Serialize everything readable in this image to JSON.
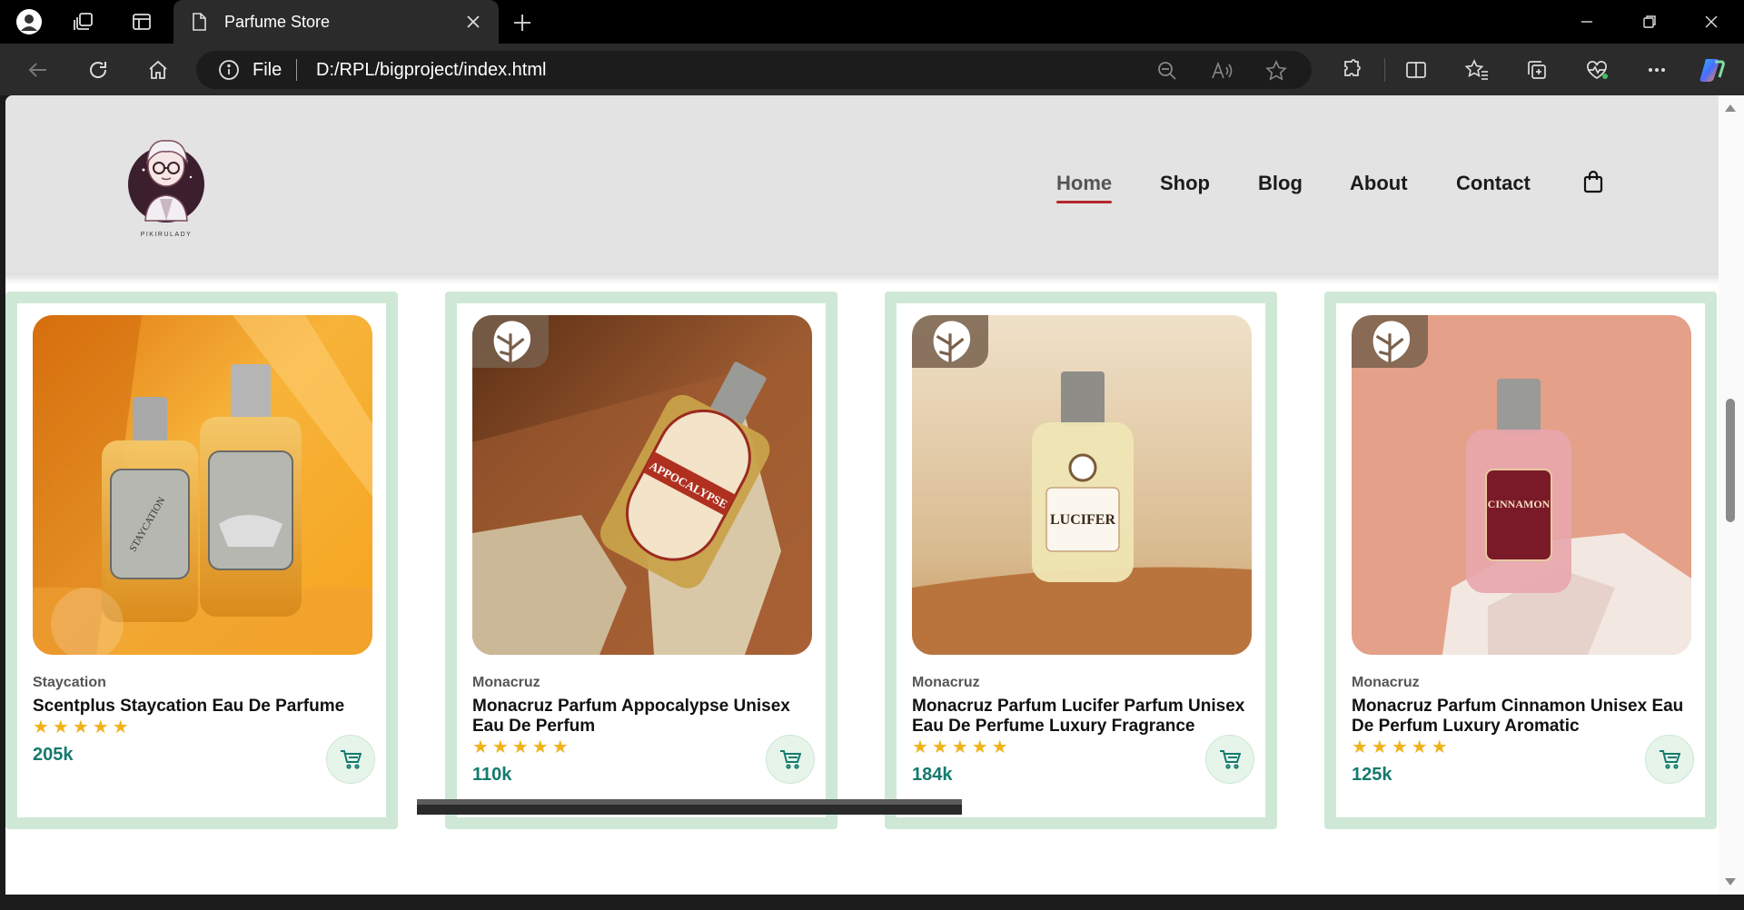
{
  "browser": {
    "tab_title": "Parfume Store",
    "address_scheme": "File",
    "address_url": "D:/RPL/bigproject/index.html"
  },
  "site": {
    "nav": [
      "Home",
      "Shop",
      "Blog",
      "About",
      "Contact"
    ],
    "active_nav": "Home",
    "logo_caption": "PIKIRULADY"
  },
  "products": [
    {
      "brand": "Staycation",
      "name": "Scentplus Staycation Eau De Parfume",
      "rating": 5,
      "price": "205k",
      "label": "STAYCATION"
    },
    {
      "brand": "Monacruz",
      "name": "Monacruz Parfum Appocalypse Unisex Eau De Perfum",
      "rating": 5,
      "price": "110k",
      "label": "APPOCALYPSE"
    },
    {
      "brand": "Monacruz",
      "name": "Monacruz Parfum Lucifer Parfum Unisex Eau De Perfume Luxury Fragrance",
      "rating": 5,
      "price": "184k",
      "label": "LUCIFER"
    },
    {
      "brand": "Monacruz",
      "name": "Monacruz Parfum Cinnamon Unisex Eau De Perfum Luxury Aromatic",
      "rating": 5,
      "price": "125k",
      "label": "CINNAMON"
    }
  ],
  "colors": {
    "accent": "#b5282b",
    "card_frame": "#cfe8d6",
    "price": "#157a6e",
    "star": "#f0b21a"
  },
  "icons": {
    "product_badge": "monstera-leaf-icon",
    "add_to_cart": "cart-icon",
    "nav_cart": "shopping-bag-icon"
  }
}
